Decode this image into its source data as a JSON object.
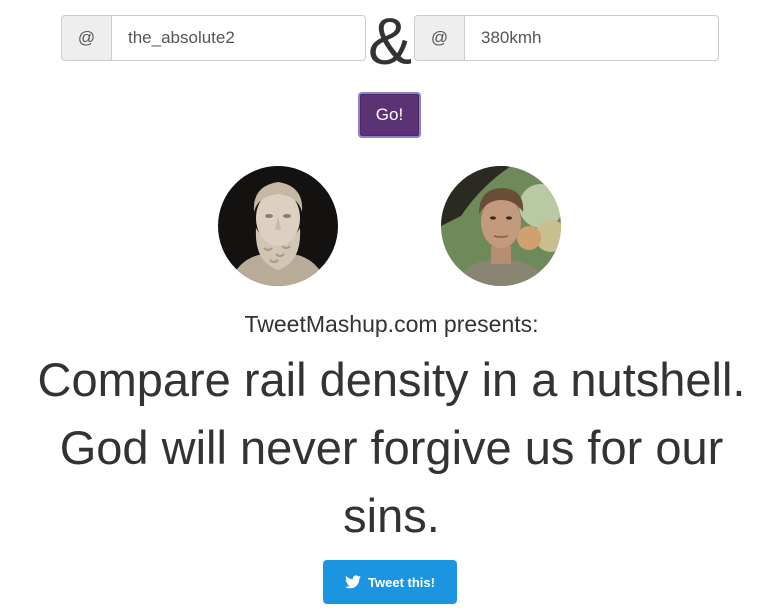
{
  "form": {
    "user1": {
      "addon": "@",
      "value": "the_absolute2"
    },
    "separator": "&",
    "user2": {
      "addon": "@",
      "value": "380kmh"
    },
    "submit_label": "Go!"
  },
  "avatars": {
    "user1_icon": "aristotle-bust-avatar",
    "user2_icon": "young-man-photo-avatar"
  },
  "result": {
    "presents": "TweetMashup.com presents:",
    "mashup_text": "Compare rail density in a nutshell. God will never forgive us for our sins."
  },
  "share": {
    "tweet_label": "Tweet this!",
    "icon": "twitter-bird-icon"
  },
  "colors": {
    "go_button": "#5b3375",
    "tweet_button": "#1b95e0",
    "text": "#333333"
  }
}
